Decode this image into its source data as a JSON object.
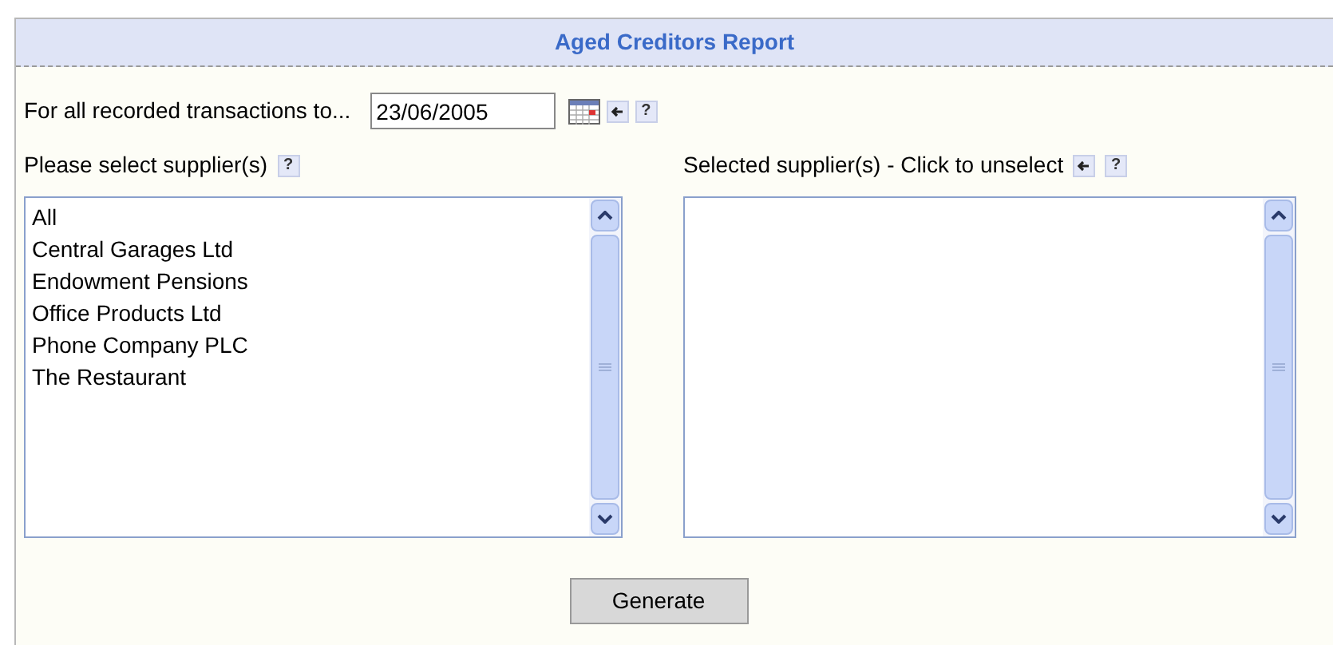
{
  "title": "Aged Creditors Report",
  "date_row": {
    "label": "For all recorded transactions to...",
    "value": "23/06/2005",
    "help": "?"
  },
  "available": {
    "label": "Please select supplier(s)",
    "help": "?",
    "items": [
      "All",
      "Central Garages Ltd",
      "Endowment Pensions",
      "Office Products Ltd",
      "Phone Company PLC",
      "The Restaurant"
    ]
  },
  "selected": {
    "label": "Selected supplier(s) - Click to unselect",
    "help": "?"
  },
  "button": "Generate"
}
